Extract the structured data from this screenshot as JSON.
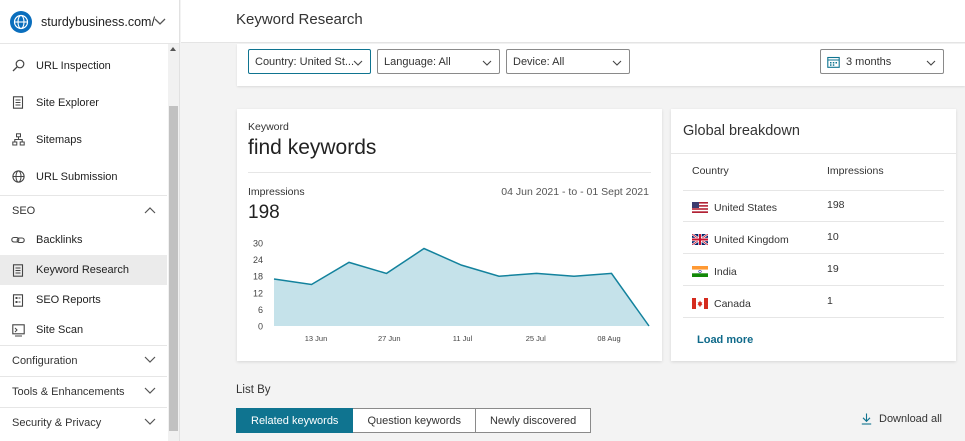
{
  "site": {
    "name": "sturdybusiness.com/"
  },
  "page": {
    "title": "Keyword Research"
  },
  "sidebar": {
    "items": [
      {
        "label": "URL Inspection",
        "icon": "search-icon"
      },
      {
        "label": "Site Explorer",
        "icon": "document-icon"
      },
      {
        "label": "Sitemaps",
        "icon": "sitemap-icon"
      },
      {
        "label": "URL Submission",
        "icon": "globe-icon"
      }
    ],
    "seo_section": {
      "label": "SEO",
      "items": [
        {
          "label": "Backlinks",
          "icon": "link-icon"
        },
        {
          "label": "Keyword Research",
          "icon": "document-icon",
          "active": true
        },
        {
          "label": "SEO Reports",
          "icon": "report-icon"
        },
        {
          "label": "Site Scan",
          "icon": "scan-icon"
        }
      ]
    },
    "sections": [
      {
        "label": "Configuration"
      },
      {
        "label": "Tools & Enhancements"
      },
      {
        "label": "Security & Privacy"
      }
    ]
  },
  "filters": {
    "country": "Country: United St...",
    "language": "Language: All",
    "device": "Device: All",
    "date_range": "3 months"
  },
  "keyword_card": {
    "label": "Keyword",
    "value": "find keywords",
    "impressions_label": "Impressions",
    "impressions_value": "198",
    "date_range": "04 Jun 2021 - to - 01 Sept 2021"
  },
  "chart_data": {
    "type": "area",
    "y_ticks": [
      "30",
      "24",
      "18",
      "12",
      "6",
      "0"
    ],
    "x_ticks": [
      "13 Jun",
      "27 Jun",
      "11 Jul",
      "25 Jul",
      "08 Aug"
    ],
    "ylim": [
      0,
      30
    ],
    "x": [
      0,
      1,
      2,
      3,
      4,
      5,
      6,
      7,
      8,
      9,
      10
    ],
    "values": [
      17,
      15,
      23,
      19,
      28,
      22,
      18,
      19,
      18,
      19,
      0
    ],
    "fill_color": "#c5e2ea",
    "line_color": "#13829d",
    "grid": false
  },
  "global_breakdown": {
    "title": "Global breakdown",
    "col_country": "Country",
    "col_impressions": "Impressions",
    "rows": [
      {
        "country": "United States",
        "impressions": "198",
        "flag": "us-flag-icon"
      },
      {
        "country": "United Kingdom",
        "impressions": "10",
        "flag": "uk-flag-icon"
      },
      {
        "country": "India",
        "impressions": "19",
        "flag": "india-flag-icon"
      },
      {
        "country": "Canada",
        "impressions": "1",
        "flag": "canada-flag-icon"
      }
    ],
    "load_more": "Load more"
  },
  "list_by": {
    "label": "List By",
    "tabs": [
      "Related keywords",
      "Question keywords",
      "Newly discovered"
    ],
    "download": "Download all"
  },
  "colors": {
    "accent": "#0f7490",
    "link": "#0f6a8a"
  }
}
